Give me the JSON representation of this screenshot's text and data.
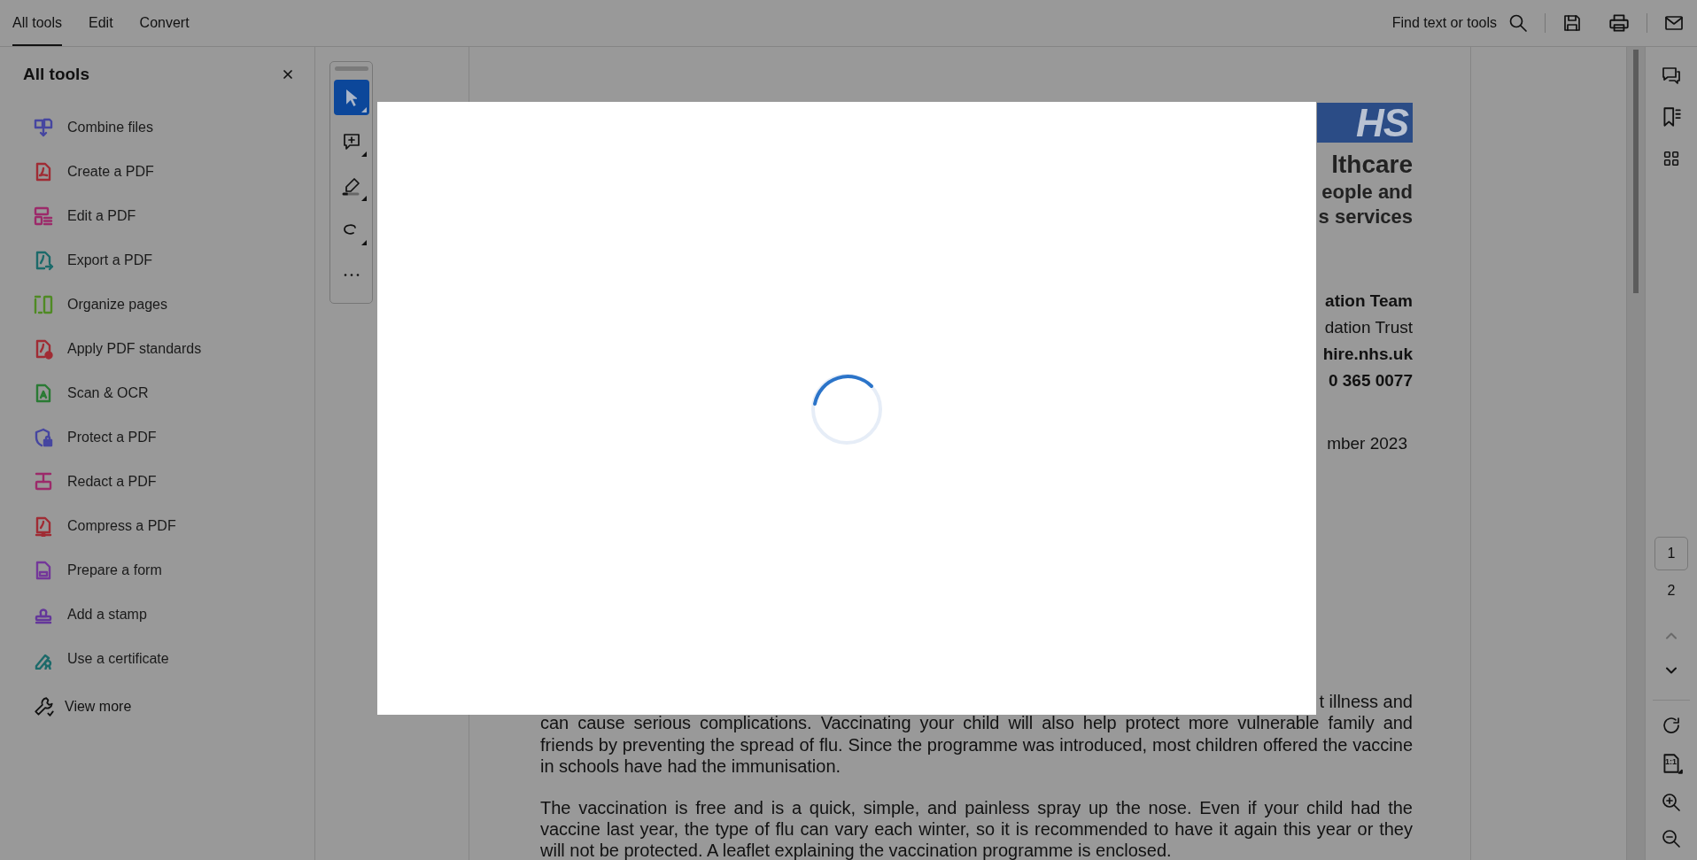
{
  "top_tabs": [
    {
      "label": "All tools",
      "selected": true
    },
    {
      "label": "Edit",
      "selected": false
    },
    {
      "label": "Convert",
      "selected": false
    }
  ],
  "search": {
    "label": "Find text or tools"
  },
  "tools_panel": {
    "title": "All tools",
    "items": [
      {
        "label": "Combine files",
        "kind": "combine",
        "color": "#4646a0"
      },
      {
        "label": "Create a PDF",
        "kind": "pdf",
        "color": "#a02c34"
      },
      {
        "label": "Edit a PDF",
        "kind": "edit",
        "color": "#9c2a6a"
      },
      {
        "label": "Export a PDF",
        "kind": "export",
        "color": "#1c6a6a"
      },
      {
        "label": "Organize pages",
        "kind": "organize",
        "color": "#4f8a24"
      },
      {
        "label": "Apply PDF standards",
        "kind": "standards",
        "color": "#a02c34"
      },
      {
        "label": "Scan & OCR",
        "kind": "scan",
        "color": "#2a7a34"
      },
      {
        "label": "Protect a PDF",
        "kind": "protect",
        "color": "#4646a0"
      },
      {
        "label": "Redact a PDF",
        "kind": "redact",
        "color": "#9c2a6a"
      },
      {
        "label": "Compress a PDF",
        "kind": "compress",
        "color": "#a02c34"
      },
      {
        "label": "Prepare a form",
        "kind": "form",
        "color": "#74379a"
      },
      {
        "label": "Add a stamp",
        "kind": "stamp",
        "color": "#64379a"
      },
      {
        "label": "Use a certificate",
        "kind": "certificate",
        "color": "#1c6a6a"
      }
    ],
    "view_more": "View more"
  },
  "toolbar": {
    "tools": [
      {
        "kind": "select",
        "selected": true
      },
      {
        "kind": "comment",
        "selected": false
      },
      {
        "kind": "highlight",
        "selected": false
      },
      {
        "kind": "draw",
        "selected": false
      },
      {
        "kind": "more",
        "selected": false
      }
    ]
  },
  "document": {
    "logo": "HS",
    "heading": [
      {
        "text": "lthcare",
        "kind": "title"
      },
      {
        "text": "eople and",
        "kind": "subtitle"
      },
      {
        "text": "s services",
        "kind": "subtitle"
      }
    ],
    "contact": [
      {
        "text": "ation Team",
        "bold": true
      },
      {
        "text": "dation Trust",
        "bold": false
      },
      {
        "text": "hire.nhs.uk",
        "bold": true
      },
      {
        "text": "0 365 0077",
        "bold": true
      }
    ],
    "date": "mber 2023",
    "fragment": "t illness and",
    "paragraphs": [
      "can cause serious complications. Vaccinating your child will also help protect more vulnerable family and friends by preventing the spread of flu. Since the programme was introduced, most children offered the vaccine in schools have had the immunisation.",
      "The vaccination is free and is a quick, simple, and painless spray up the nose. Even if your child had the vaccine last year, the type of flu can vary each winter, so it is recommended to have it again this year or they will not be protected. A leaflet explaining the vaccination programme is enclosed."
    ]
  },
  "page_nav": {
    "pages": [
      {
        "label": "1",
        "selected": true
      },
      {
        "label": "2",
        "selected": false
      }
    ],
    "fit_label": "1:1"
  }
}
